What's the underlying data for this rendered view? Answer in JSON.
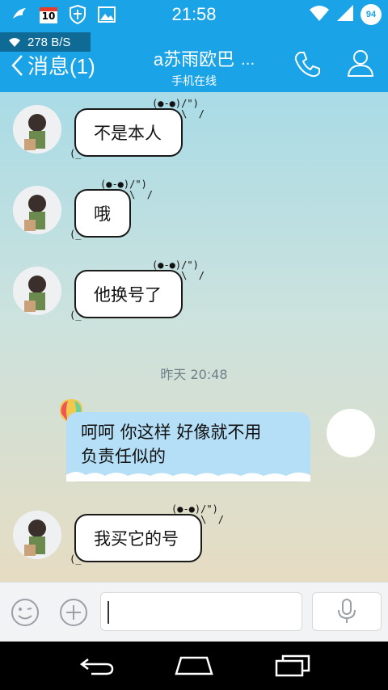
{
  "status_bar": {
    "time": "21:58",
    "calendar_day": "10",
    "battery": "94",
    "icons": [
      "bird-icon",
      "calendar-icon",
      "shield-icon",
      "image-icon",
      "wifi-icon",
      "signal-icon",
      "battery-icon"
    ]
  },
  "header": {
    "network_speed": "278 B/S",
    "back_label": "消息(1)",
    "contact_name": "a苏雨欧巴",
    "contact_status": "手机在线",
    "more_label": "...",
    "accent_color": "#1aa3e6"
  },
  "messages": [
    {
      "sender": "contact",
      "text": "不是本人"
    },
    {
      "sender": "contact",
      "text": "哦"
    },
    {
      "sender": "contact",
      "text": "他换号了"
    },
    {
      "type": "timestamp",
      "text": "昨天 20:48"
    },
    {
      "sender": "me",
      "line1": "呵呵  你这样  好像就不用",
      "line2": "负责任似的"
    },
    {
      "sender": "contact",
      "text": "我买它的号"
    }
  ],
  "bubble_decoration": {
    "face": "(●-●)/\")",
    "mouth": "o    \\  /",
    "bottom": "(_"
  },
  "input_bar": {
    "text_value": "",
    "icons": [
      "emoji-icon",
      "plus-icon",
      "microphone-icon"
    ]
  },
  "nav_bar": {
    "icons": [
      "back-icon",
      "home-icon",
      "recents-icon"
    ]
  }
}
